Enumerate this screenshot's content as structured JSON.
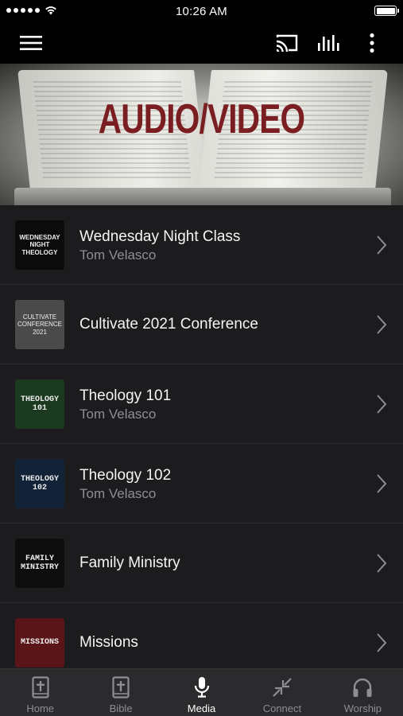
{
  "status_bar": {
    "time": "10:26 AM",
    "signal_bars": 5
  },
  "toolbar": {
    "icons": [
      "menu-icon",
      "cast-icon",
      "equalizer-icon",
      "more-vertical-icon"
    ]
  },
  "banner": {
    "title": "AUDIO/VIDEO"
  },
  "series": [
    {
      "title": "Wednesday Night Class",
      "speaker": "Tom Velasco",
      "thumb_text": "WEDNESDAY NIGHT THEOLOGY",
      "thumb_bg": "#0b0b0b"
    },
    {
      "title": "Cultivate 2021 Conference",
      "speaker": "",
      "thumb_text": "CULTIVATE CONFERENCE 2021",
      "thumb_bg": "#4a4a4a"
    },
    {
      "title": "Theology 101",
      "speaker": "Tom Velasco",
      "thumb_text": "THEOLOGY 101",
      "thumb_bg": "#1b3a1f"
    },
    {
      "title": "Theology 102",
      "speaker": "Tom Velasco",
      "thumb_text": "THEOLOGY 102",
      "thumb_bg": "#122338"
    },
    {
      "title": "Family Ministry",
      "speaker": "",
      "thumb_text": "FAMILY MINISTRY",
      "thumb_bg": "#0d0d0d"
    },
    {
      "title": "Missions",
      "speaker": "",
      "thumb_text": "MISSIONS",
      "thumb_bg": "#5a1518"
    }
  ],
  "tabs": [
    {
      "label": "Home",
      "icon": "bible-icon",
      "active": false
    },
    {
      "label": "Bible",
      "icon": "bible-icon",
      "active": false
    },
    {
      "label": "Media",
      "icon": "microphone-icon",
      "active": true
    },
    {
      "label": "Connect",
      "icon": "collapse-arrows-icon",
      "active": false
    },
    {
      "label": "Worship",
      "icon": "headphones-icon",
      "active": false
    }
  ],
  "colors": {
    "accent_title": "#7a1e22",
    "background": "#1c1c1e",
    "tabbar": "#2b2b2d"
  }
}
